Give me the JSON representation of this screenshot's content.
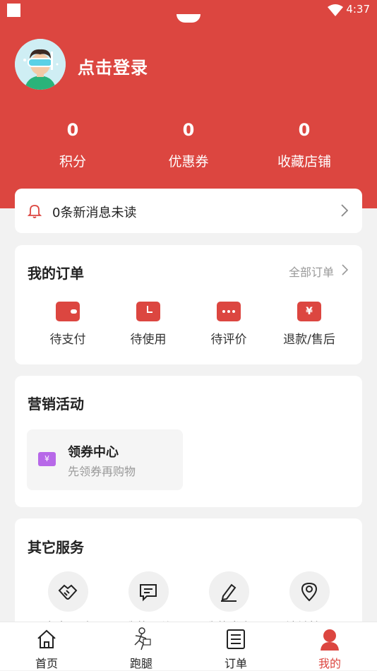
{
  "status_bar": {
    "time": "4:37"
  },
  "profile": {
    "login_label": "点击登录"
  },
  "stats": [
    {
      "value": "0",
      "label": "积分"
    },
    {
      "value": "0",
      "label": "优惠券"
    },
    {
      "value": "0",
      "label": "收藏店铺"
    }
  ],
  "messages": {
    "text": "0条新消息未读"
  },
  "orders": {
    "title": "我的订单",
    "all_label": "全部订单",
    "items": [
      {
        "label": "待支付",
        "icon": "wallet-icon"
      },
      {
        "label": "待使用",
        "icon": "clock-icon"
      },
      {
        "label": "待评价",
        "icon": "comment-icon"
      },
      {
        "label": "退款/售后",
        "icon": "yen-icon"
      }
    ]
  },
  "promo": {
    "title": "营销活动",
    "coupon_title": "领券中心",
    "coupon_sub": "先领券再购物"
  },
  "services": {
    "title": "其它服务",
    "items": [
      {
        "label": "商家入驻",
        "icon": "handshake-icon"
      },
      {
        "label": "我的评价",
        "icon": "message-icon"
      },
      {
        "label": "我的发布",
        "icon": "edit-icon"
      },
      {
        "label": "地址管理",
        "icon": "location-icon"
      }
    ]
  },
  "tabbar": {
    "items": [
      {
        "label": "首页",
        "icon": "home-icon"
      },
      {
        "label": "跑腿",
        "icon": "runner-icon"
      },
      {
        "label": "订单",
        "icon": "order-list-icon"
      },
      {
        "label": "我的",
        "icon": "user-icon"
      }
    ],
    "active_color": "#dc4640"
  },
  "colors": {
    "brand": "#dc4640",
    "coupon": "#b768e8"
  }
}
